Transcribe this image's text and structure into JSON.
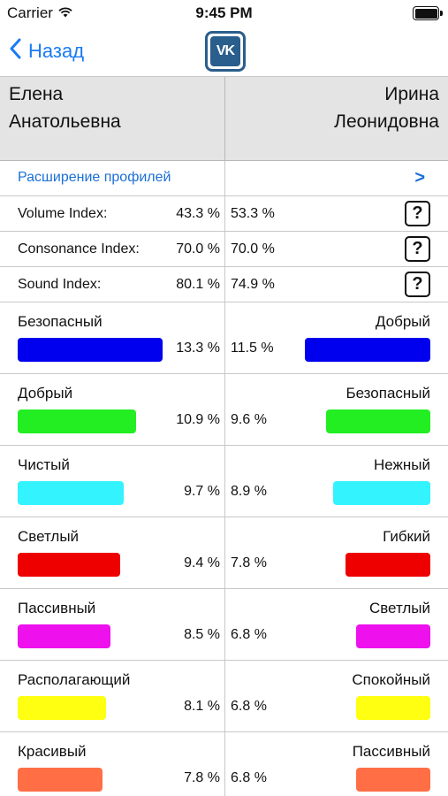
{
  "status_bar": {
    "carrier": "Carrier",
    "time": "9:45 PM",
    "wifi_icon": "wifi-icon",
    "battery_icon": "battery-icon"
  },
  "nav": {
    "back_label": "Назад",
    "back_icon": "chevron-left-icon",
    "logo_text": "VK",
    "logo_color": "#2a5e8c",
    "accent": "#1a7bf5"
  },
  "names": {
    "left": {
      "first": "Елена",
      "patronymic": "Анатольевна"
    },
    "right": {
      "first": "Ирина",
      "patronymic": "Леонидовна"
    }
  },
  "profile_extension": {
    "label": "Расширение профилей",
    "arrow": ">"
  },
  "indices": [
    {
      "label": "Volume Index:",
      "left": "43.3 %",
      "right": "53.3 %",
      "help": "?"
    },
    {
      "label": "Consonance Index:",
      "left": "70.0 %",
      "right": "70.0 %",
      "help": "?"
    },
    {
      "label": "Sound Index:",
      "left": "80.1 %",
      "right": "74.9 %",
      "help": "?"
    }
  ],
  "traits": [
    {
      "left_label": "Безопасный",
      "left_pct": "13.3 %",
      "left_value": 13.3,
      "left_color": "#0000ee",
      "right_label": "Добрый",
      "right_pct": "11.5 %",
      "right_value": 11.5,
      "right_color": "#0000ee"
    },
    {
      "left_label": "Добрый",
      "left_pct": "10.9 %",
      "left_value": 10.9,
      "left_color": "#22ee22",
      "right_label": "Безопасный",
      "right_pct": "9.6 %",
      "right_value": 9.6,
      "right_color": "#22ee22"
    },
    {
      "left_label": "Чистый",
      "left_pct": "9.7 %",
      "left_value": 9.7,
      "left_color": "#33f3ff",
      "right_label": "Нежный",
      "right_pct": "8.9 %",
      "right_value": 8.9,
      "right_color": "#33f3ff"
    },
    {
      "left_label": "Светлый",
      "left_pct": "9.4 %",
      "left_value": 9.4,
      "left_color": "#ee0000",
      "right_label": "Гибкий",
      "right_pct": "7.8 %",
      "right_value": 7.8,
      "right_color": "#ee0000"
    },
    {
      "left_label": "Пассивный",
      "left_pct": "8.5 %",
      "left_value": 8.5,
      "left_color": "#ee11ee",
      "right_label": "Светлый",
      "right_pct": "6.8 %",
      "right_value": 6.8,
      "right_color": "#ee11ee"
    },
    {
      "left_label": "Располагающий",
      "left_pct": "8.1 %",
      "left_value": 8.1,
      "left_color": "#ffff11",
      "right_label": "Спокойный",
      "right_pct": "6.8 %",
      "right_value": 6.8,
      "right_color": "#ffff11"
    },
    {
      "left_label": "Красивый",
      "left_pct": "7.8 %",
      "left_value": 7.8,
      "left_color": "#ff6e45",
      "right_label": "Пассивный",
      "right_pct": "6.8 %",
      "right_value": 6.8,
      "right_color": "#ff6e45"
    }
  ]
}
